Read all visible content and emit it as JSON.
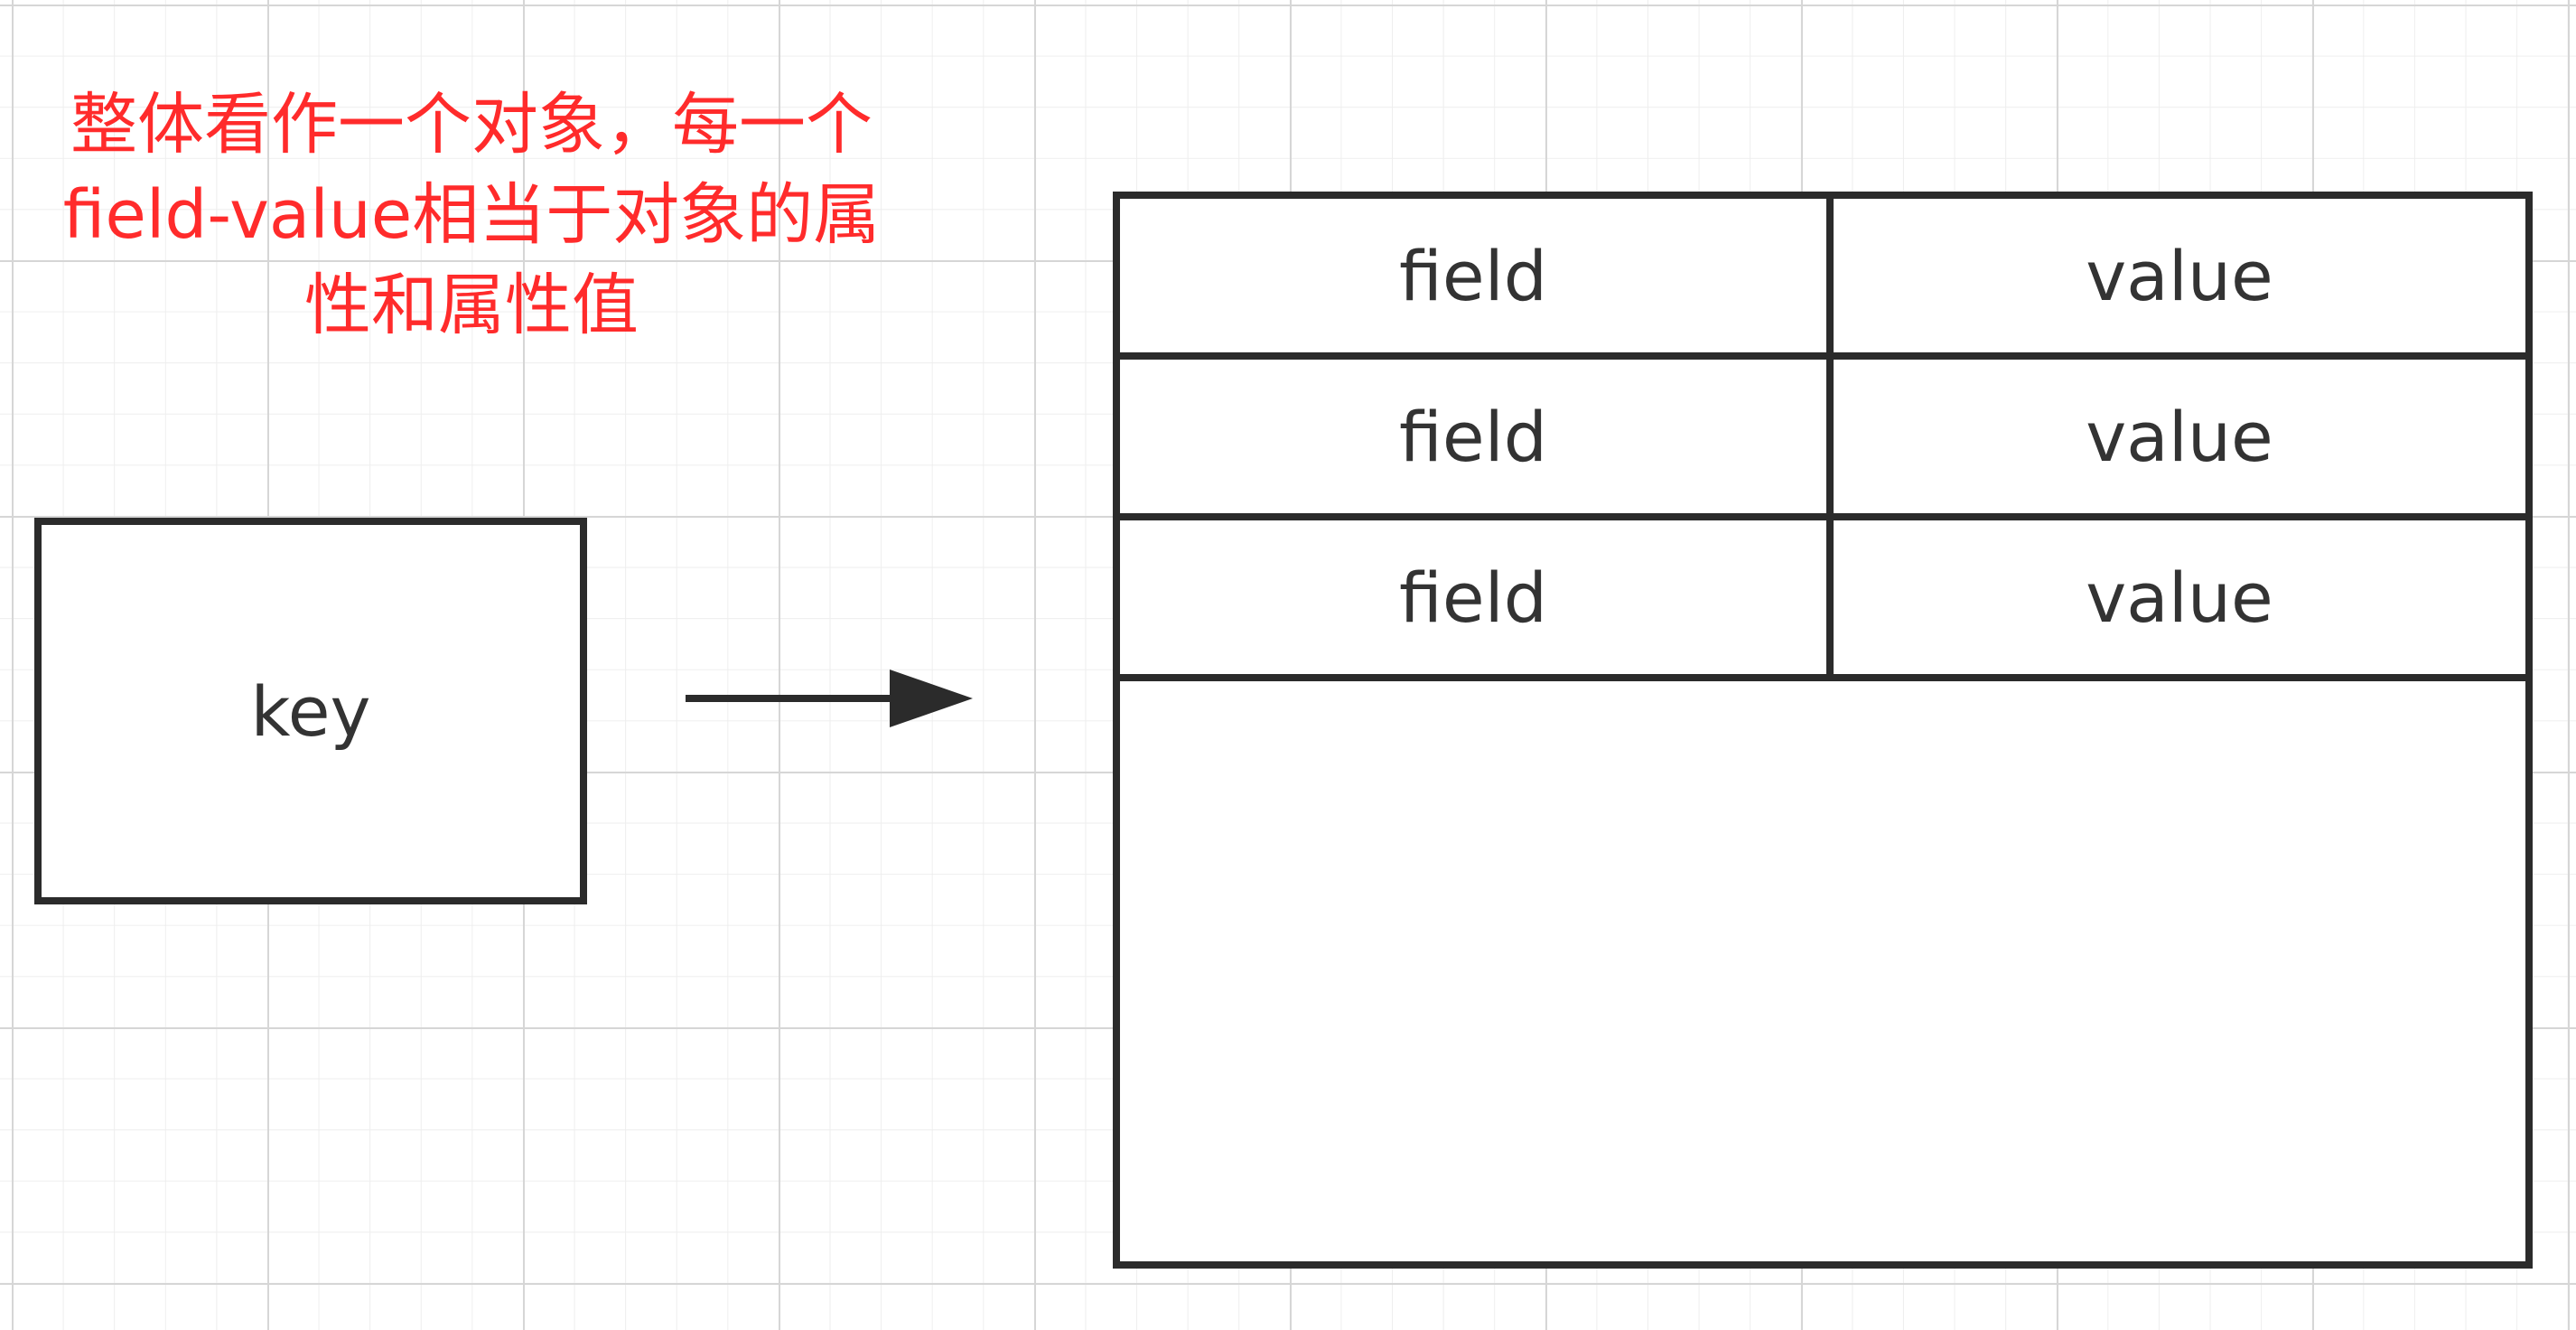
{
  "annotation": {
    "text": "整体看作一个对象，每一个\nfield-value相当于对象的属\n性和属性值",
    "color": "#ff2b2b"
  },
  "key_box": {
    "label": "key"
  },
  "hash_table": {
    "rows": [
      {
        "field": "field",
        "value": "value"
      },
      {
        "field": "field",
        "value": "value"
      },
      {
        "field": "field",
        "value": "value"
      }
    ]
  },
  "colors": {
    "stroke": "#2b2b2b",
    "text": "#333333",
    "grid": "#d6d6d6"
  }
}
